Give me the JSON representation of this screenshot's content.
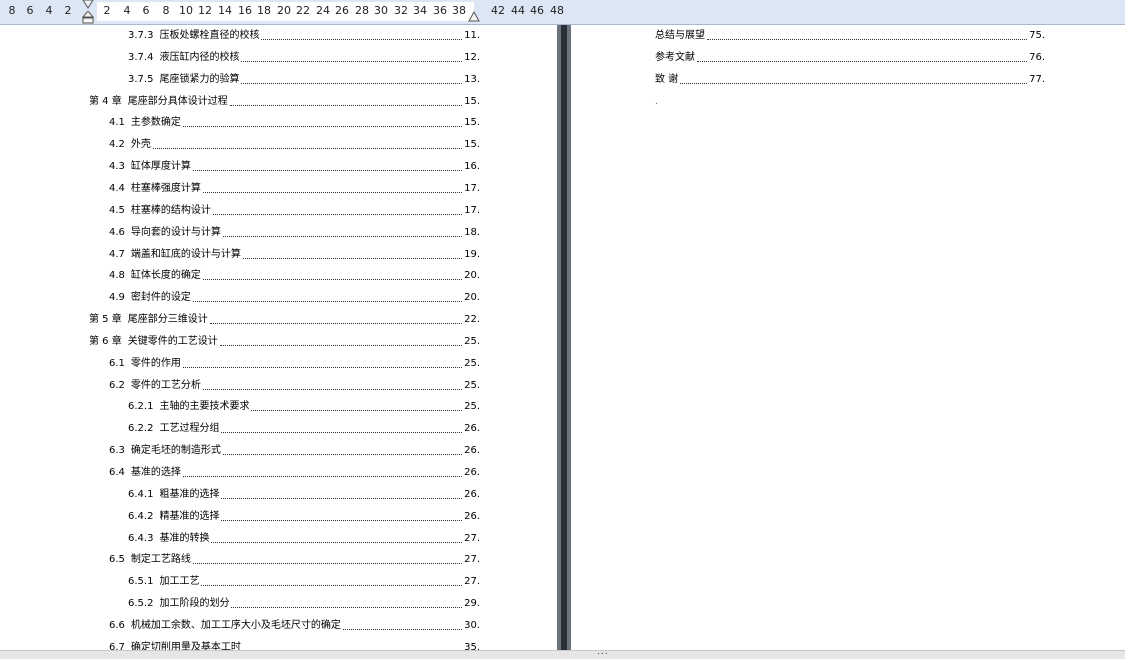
{
  "ruler": {
    "numbers": [
      "8",
      "6",
      "4",
      "2",
      "2",
      "4",
      "6",
      "8",
      "10",
      "12",
      "14",
      "16",
      "18",
      "20",
      "22",
      "24",
      "26",
      "28",
      "30",
      "32",
      "34",
      "36",
      "38",
      "42",
      "44",
      "46",
      "48"
    ]
  },
  "left_page": {
    "entries": [
      {
        "num": "3.7.3",
        "text": "压板处螺栓直径的校核",
        "page": "11."
      },
      {
        "num": "3.7.4",
        "text": "液压缸内径的校核",
        "page": "12."
      },
      {
        "num": "3.7.5",
        "text": "尾座锁紧力的验算",
        "page": "13."
      },
      {
        "num": "第 4 章",
        "text": "尾座部分具体设计过程",
        "page": "15."
      },
      {
        "num": "4.1",
        "text": "主参数确定",
        "page": "15."
      },
      {
        "num": "4.2",
        "text": "外壳",
        "page": "15."
      },
      {
        "num": "4.3",
        "text": "缸体厚度计算",
        "page": "16."
      },
      {
        "num": "4.4",
        "text": "柱塞棒强度计算",
        "page": "17."
      },
      {
        "num": "4.5",
        "text": "柱塞棒的结构设计",
        "page": "17."
      },
      {
        "num": "4.6",
        "text": "导向套的设计与计算",
        "page": "18."
      },
      {
        "num": "4.7",
        "text": "端盖和缸底的设计与计算",
        "page": "19."
      },
      {
        "num": "4.8",
        "text": "缸体长度的确定",
        "page": "20."
      },
      {
        "num": "4.9",
        "text": "密封件的设定",
        "page": "20."
      },
      {
        "num": "第 5 章",
        "text": "尾座部分三维设计",
        "page": "22."
      },
      {
        "num": "第 6 章",
        "text": "关键零件的工艺设计",
        "page": "25."
      },
      {
        "num": "6.1",
        "text": "零件的作用",
        "page": "25."
      },
      {
        "num": "6.2",
        "text": "零件的工艺分析",
        "page": "25."
      },
      {
        "num": "6.2.1",
        "text": "主轴的主要技术要求",
        "page": "25."
      },
      {
        "num": "6.2.2",
        "text": "工艺过程分组",
        "page": "26."
      },
      {
        "num": "6.3",
        "text": "确定毛坯的制造形式",
        "page": "26."
      },
      {
        "num": "6.4",
        "text": "基准的选择",
        "page": "26."
      },
      {
        "num": "6.4.1",
        "text": "粗基准的选择",
        "page": "26."
      },
      {
        "num": "6.4.2",
        "text": "精基准的选择",
        "page": "26."
      },
      {
        "num": "6.4.3",
        "text": "基准的转换",
        "page": "27."
      },
      {
        "num": "6.5",
        "text": "制定工艺路线",
        "page": "27."
      },
      {
        "num": "6.5.1",
        "text": "加工工艺",
        "page": "27."
      },
      {
        "num": "6.5.2",
        "text": "加工阶段的划分",
        "page": "29."
      },
      {
        "num": "6.6",
        "text": "机械加工余数、加工工序大小及毛坯尺寸的确定",
        "page": "30."
      },
      {
        "num": "6.7",
        "text": "确定切削用量及基本工时",
        "page": "35."
      }
    ]
  },
  "right_page": {
    "entries": [
      {
        "num": "",
        "text": "总结与展望",
        "page": "75."
      },
      {
        "num": "",
        "text": "参考文献",
        "page": "76."
      },
      {
        "num": "",
        "text": "致  谢",
        "page": "77."
      }
    ],
    "paragraph_mark": "."
  },
  "statusbar": {
    "dots": "..."
  },
  "colors": {
    "ruler_bg": "#dce6f4",
    "gutter": "#6b7380"
  }
}
